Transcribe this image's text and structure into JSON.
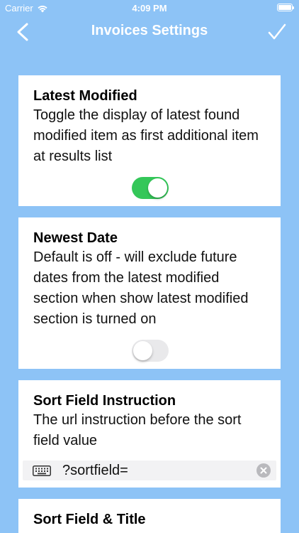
{
  "status_bar": {
    "carrier": "Carrier",
    "time": "4:09 PM"
  },
  "nav": {
    "title": "Invoices Settings",
    "back_icon": "chevron-left-icon",
    "done_icon": "checkmark-icon"
  },
  "cards": [
    {
      "title": "Latest Modified",
      "description": "Toggle the display of latest found modified item as first additional item at results list",
      "toggle_on": true
    },
    {
      "title": "Newest Date",
      "description": "Default is off - will exclude future dates from the latest modified section when show latest modified section is turned on",
      "toggle_on": false
    },
    {
      "title": "Sort Field Instruction",
      "description": "The url instruction before the sort field value",
      "field_value": "?sortfield="
    },
    {
      "title": "Sort Field & Title"
    }
  ],
  "colors": {
    "background": "#8dc3f6",
    "toggle_on": "#34c759",
    "toggle_off": "#e9e9eb"
  }
}
